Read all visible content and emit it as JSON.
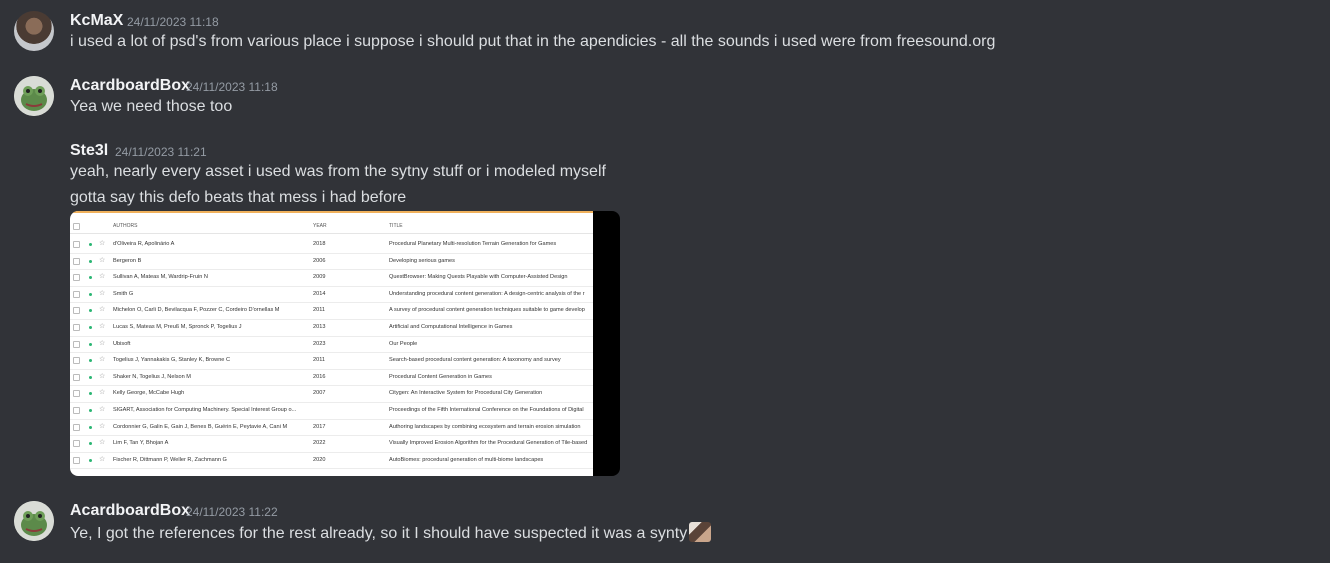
{
  "messages": [
    {
      "author": "KcMaX",
      "timestamp": "24/11/2023 11:18",
      "lines": [
        "i used a lot of psd's from various place i suppose i should put that in the apendicies - all the sounds i used were from freesound.org"
      ]
    },
    {
      "author": "AcardboardBox",
      "timestamp": "24/11/2023 11:18",
      "lines": [
        "Yea we need those too"
      ]
    },
    {
      "author": "Ste3l",
      "timestamp": "24/11/2023 11:21",
      "lines": [
        "yeah, nearly every asset i used was from the sytny stuff or i modeled myself",
        "gotta say this defo beats that mess i had before"
      ]
    },
    {
      "author": "AcardboardBox",
      "timestamp": "24/11/2023 11:22",
      "lines": [
        "Ye, I got the references for the rest already, so it I should have suspected it was a synty"
      ]
    }
  ],
  "attachment": {
    "headers": {
      "authors": "AUTHORS",
      "year": "YEAR",
      "title": "TITLE"
    },
    "rows": [
      {
        "authors": "d'Oliveira R, Apolinário A",
        "year": "2018",
        "title": "Procedural Planetary Multi-resolution Terrain Generation for Games"
      },
      {
        "authors": "Bergeron B",
        "year": "2006",
        "title": "Developing serious games"
      },
      {
        "authors": "Sullivan A, Mateas M, Wardrip-Fruin N",
        "year": "2009",
        "title": "QuestBrowser: Making Quests Playable with Computer-Assisted Design"
      },
      {
        "authors": "Smith G",
        "year": "2014",
        "title": "Understanding procedural content generation: A design-centric analysis of the r"
      },
      {
        "authors": "Michelon O, Carli D, Bevilacqua F, Pozzer C, Cordeiro D'ornellas M",
        "year": "2011",
        "title": "A survey of procedural content generation techniques suitable to game develop"
      },
      {
        "authors": "Lucas S, Mateas M, Preuß M, Spronck P, Togelius J",
        "year": "2013",
        "title": "Artificial and Computational Intelligence in Games"
      },
      {
        "authors": "Ubisoft",
        "year": "2023",
        "title": "Our People"
      },
      {
        "authors": "Togelius J, Yannakakis G, Stanley K, Browne C",
        "year": "2011",
        "title": "Search-based procedural content generation: A taxonomy and survey"
      },
      {
        "authors": "Shaker N, Togelius J, Nelson M",
        "year": "2016",
        "title": "Procedural Content Generation in Games"
      },
      {
        "authors": "Kelly George, McCabe Hugh",
        "year": "2007",
        "title": "Citygen: An Interactive System for Procedural City Generation"
      },
      {
        "authors": "SIGART, Association for Computing Machinery. Special Interest Group o...",
        "year": "",
        "title": "Proceedings of the Fifth International Conference on the Foundations of Digital"
      },
      {
        "authors": "Cordonnier G, Galin E, Gain J, Benes B, Guérin E, Peytavie A, Cani M",
        "year": "2017",
        "title": "Authoring landscapes by combining ecosystem and terrain erosion simulation"
      },
      {
        "authors": "Lim F, Tan Y, Bhojan A",
        "year": "2022",
        "title": "Visually Improved Erosion Algorithm for the Procedural Generation of Tile-based"
      },
      {
        "authors": "Fischer R, Dittmann P, Weller R, Zachmann G",
        "year": "2020",
        "title": "AutoBiomes: procedural generation of multi-biome landscapes"
      }
    ]
  }
}
